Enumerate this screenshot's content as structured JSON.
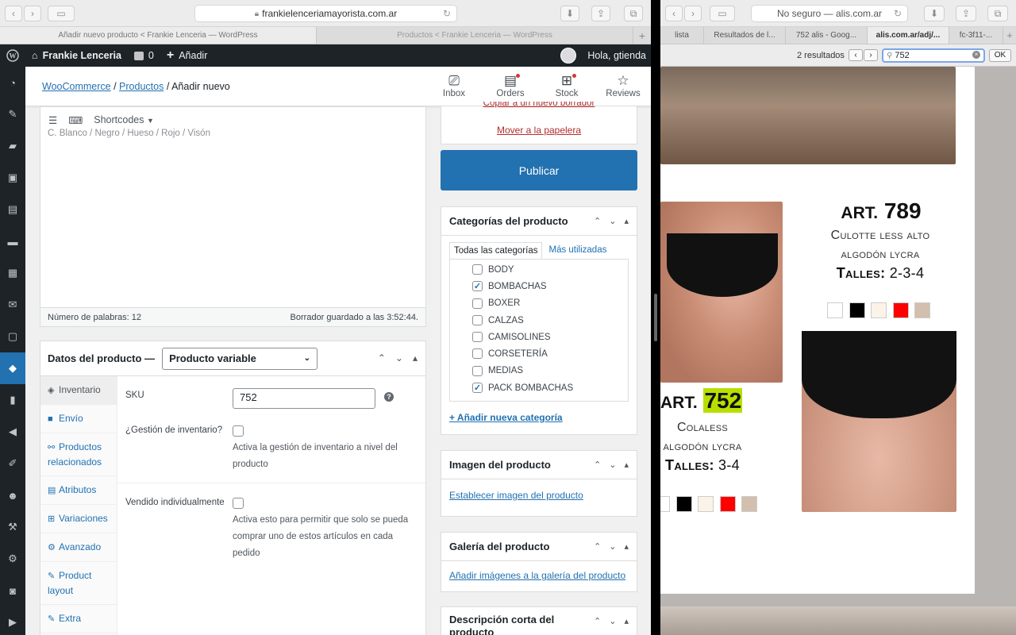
{
  "left_browser": {
    "url": "frankielenceriamayorista.com.ar",
    "tabs": [
      "Añadir nuevo producto < Frankie Lenceria — WordPress",
      "Productos < Frankie Lenceria — WordPress"
    ]
  },
  "adminbar": {
    "site_name": "Frankie Lenceria",
    "comments_count": "0",
    "new_label": "Añadir",
    "greeting": "Hola, gtienda"
  },
  "breadcrumb": {
    "woocommerce": "WooCommerce",
    "productos": "Productos",
    "current": "Añadir nuevo"
  },
  "header_icons": [
    {
      "label": "Inbox",
      "icon": "inbox-icon"
    },
    {
      "label": "Orders",
      "icon": "orders-icon"
    },
    {
      "label": "Stock",
      "icon": "stock-icon"
    },
    {
      "label": "Reviews",
      "icon": "star-icon"
    }
  ],
  "editor": {
    "shortcodes_label": "Shortcodes",
    "content_line": "C. Blanco / Negro / Hueso / Rojo / Visón",
    "word_count": "Número de palabras: 12",
    "draft_saved": "Borrador guardado a las 3:52:44."
  },
  "product_data": {
    "title": "Datos del producto —",
    "type": "Producto variable",
    "tabs": [
      {
        "label": "Inventario",
        "icon": "tag-icon"
      },
      {
        "label": "Envío",
        "icon": "truck-icon"
      },
      {
        "label": "Productos relacionados",
        "icon": "link-icon"
      },
      {
        "label": "Atributos",
        "icon": "list-icon"
      },
      {
        "label": "Variaciones",
        "icon": "grid-icon"
      },
      {
        "label": "Avanzado",
        "icon": "gear-icon"
      },
      {
        "label": "Product layout",
        "icon": "wrench-icon"
      },
      {
        "label": "Extra",
        "icon": "wrench-icon"
      }
    ],
    "sku_label": "SKU",
    "sku_value": "752",
    "manage_stock_label": "¿Gestión de inventario?",
    "manage_stock_desc": "Activa la gestión de inventario a nivel del producto",
    "sold_individually_label": "Vendido individualmente",
    "sold_individually_desc": "Activa esto para permitir que solo se pueda comprar uno de estos artículos en cada pedido"
  },
  "publish_box": {
    "copy_link": "Copiar a un nuevo borrador",
    "trash_link": "Mover a la papelera",
    "publish_button": "Publicar"
  },
  "categories": {
    "title": "Categorías del producto",
    "tab_all": "Todas las categorías",
    "tab_most_used": "Más utilizadas",
    "items": [
      {
        "label": "BODY",
        "checked": false
      },
      {
        "label": "BOMBACHAS",
        "checked": true
      },
      {
        "label": "BOXER",
        "checked": false
      },
      {
        "label": "CALZAS",
        "checked": false
      },
      {
        "label": "CAMISOLINES",
        "checked": false
      },
      {
        "label": "CORSETERÍA",
        "checked": false
      },
      {
        "label": "MEDIAS",
        "checked": false
      },
      {
        "label": "PACK BOMBACHAS",
        "checked": true
      }
    ],
    "add_new": "+ Añadir nueva categoría"
  },
  "image_box": {
    "title": "Imagen del producto",
    "link": "Establecer imagen del producto"
  },
  "gallery_box": {
    "title": "Galería del producto",
    "link": "Añadir imágenes a la galería del producto"
  },
  "short_desc_box": {
    "title": "Descripción corta del producto"
  },
  "right_browser": {
    "url": "No seguro — alis.com.ar",
    "tabs": [
      "lista",
      "Resultados de l...",
      "752 alis - Goog...",
      "alis.com.ar/adj/...",
      "fc-3f11-..."
    ],
    "find_results": "2 resultados",
    "find_query": "752",
    "ok_label": "OK"
  },
  "catalog": {
    "art1_prefix": "ART.",
    "art1_number": "789",
    "art1_name": "Culotte less alto",
    "art1_material": "algodón lycra",
    "art1_sizes_label": "Talles:",
    "art1_sizes": "2-3-4",
    "art2_prefix": "ART.",
    "art2_number": "752",
    "art2_name": "Colaless",
    "art2_material": "algodón lycra",
    "art2_sizes_label": "Talles:",
    "art2_sizes": "3-4",
    "swatch_colors": [
      "#ffffff",
      "#000000",
      "#fbf3e8",
      "#ff0000",
      "#d2bfad"
    ],
    "highlight_color": "#b7e000"
  }
}
